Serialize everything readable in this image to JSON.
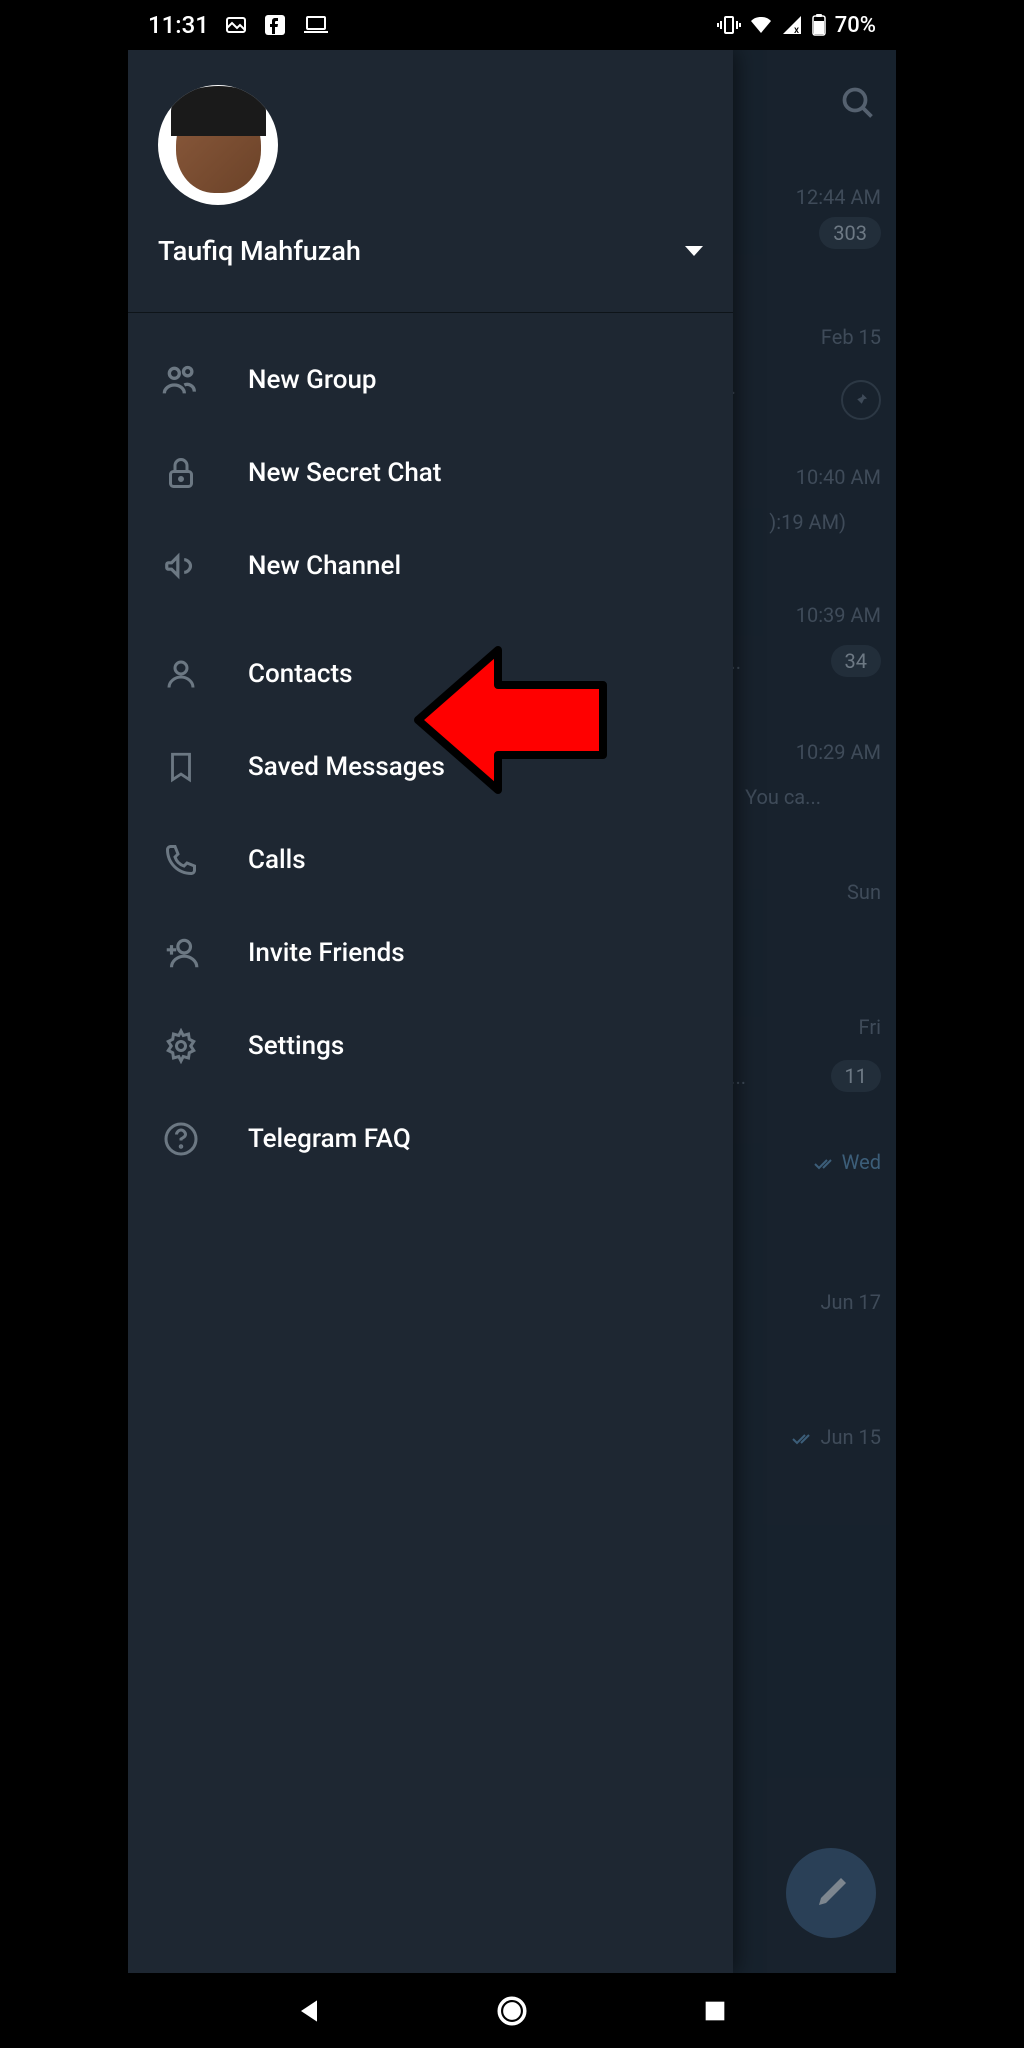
{
  "statusBar": {
    "time": "11:31",
    "battery": "70%"
  },
  "user": {
    "name": "Taufiq Mahfuzah"
  },
  "menu": {
    "items": [
      {
        "label": "New Group"
      },
      {
        "label": "New Secret Chat"
      },
      {
        "label": "New Channel"
      },
      {
        "label": "Contacts"
      },
      {
        "label": "Saved Messages"
      },
      {
        "label": "Calls"
      },
      {
        "label": "Invite Friends"
      },
      {
        "label": "Settings"
      },
      {
        "label": "Telegram FAQ"
      }
    ]
  },
  "chatBackground": {
    "items": [
      {
        "time": "12:44 AM",
        "badge": "303"
      },
      {
        "time": "Feb 15",
        "subtext": "i..."
      },
      {
        "time": "10:40 AM",
        "subtext": "):19 AM)"
      },
      {
        "time": "10:39 AM",
        "subtext": "p...",
        "badge": "34"
      },
      {
        "time": "10:29 AM",
        "subtext": "You ca..."
      },
      {
        "time": "Sun"
      },
      {
        "time": "Fri",
        "subtext": "a...",
        "badge": "11"
      },
      {
        "time": "Wed"
      },
      {
        "time": "Jun 17"
      },
      {
        "subtext": "Jun 15"
      }
    ]
  }
}
